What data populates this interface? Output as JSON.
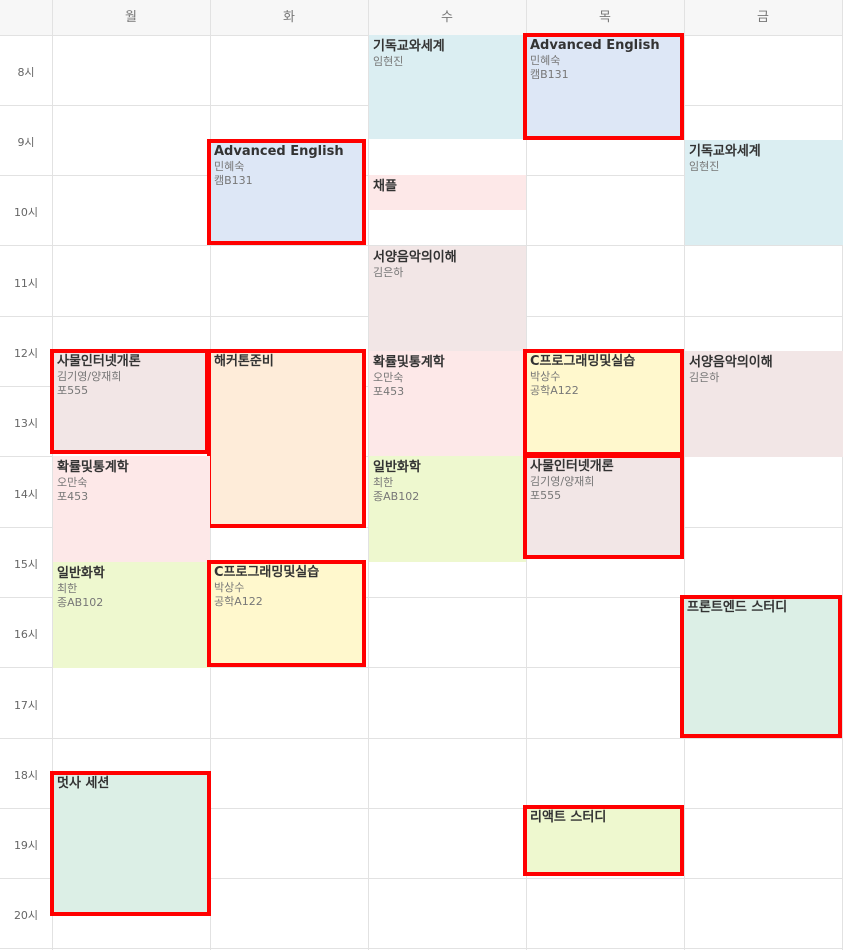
{
  "days": [
    "월",
    "화",
    "수",
    "목",
    "금"
  ],
  "hours": [
    "8시",
    "9시",
    "10시",
    "11시",
    "12시",
    "13시",
    "14시",
    "15시",
    "16시",
    "17시",
    "18시",
    "19시",
    "20시"
  ],
  "colors": {
    "blue": "#dde7f6",
    "teal": "#dbeef2",
    "pink": "#fde8e8",
    "mauve": "#f2e6e6",
    "peach": "#feecd9",
    "yellow": "#fff8cd",
    "lime": "#eef8cf",
    "mint": "#dcefe6",
    "highlight": "#ff0000"
  },
  "events": [
    {
      "title": "기독교와세계",
      "prof": "임현진",
      "room": ""
    },
    {
      "title": "Advanced English",
      "prof": "민혜숙",
      "room": "캠B131"
    },
    {
      "title": "Advanced English",
      "prof": "민혜숙",
      "room": "캠B131"
    },
    {
      "title": "기독교와세계",
      "prof": "임현진",
      "room": ""
    },
    {
      "title": "채플",
      "prof": "",
      "room": ""
    },
    {
      "title": "서양음악의이해",
      "prof": "김은하",
      "room": ""
    },
    {
      "title": "사물인터넷개론",
      "prof": "김기영/양재희",
      "room": "포555"
    },
    {
      "title": "해커톤준비",
      "prof": "",
      "room": ""
    },
    {
      "title": "확률및통계학",
      "prof": "오만숙",
      "room": "포453"
    },
    {
      "title": "C프로그래밍및실습",
      "prof": "박상수",
      "room": "공학A122"
    },
    {
      "title": "서양음악의이해",
      "prof": "김은하",
      "room": ""
    },
    {
      "title": "확률및통계학",
      "prof": "오만숙",
      "room": "포453"
    },
    {
      "title": "일반화학",
      "prof": "최한",
      "room": "종AB102"
    },
    {
      "title": "사물인터넷개론",
      "prof": "김기영/양재희",
      "room": "포555"
    },
    {
      "title": "일반화학",
      "prof": "최한",
      "room": "종AB102"
    },
    {
      "title": "C프로그래밍및실습",
      "prof": "박상수",
      "room": "공학A122"
    },
    {
      "title": "프론트엔드 스터디",
      "prof": "",
      "room": ""
    },
    {
      "title": "멋사 세션",
      "prof": "",
      "room": ""
    },
    {
      "title": "리액트 스터디",
      "prof": "",
      "room": ""
    }
  ]
}
